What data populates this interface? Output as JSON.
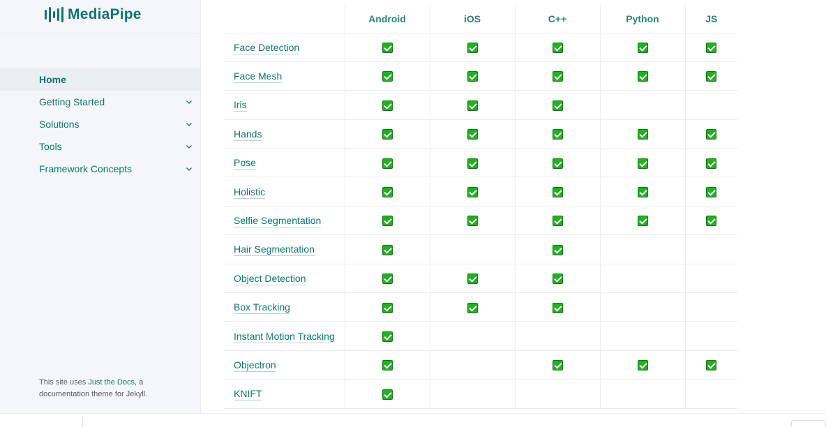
{
  "brand": {
    "name": "MediaPipe"
  },
  "nav": {
    "items": [
      {
        "label": "Home",
        "active": true,
        "expandable": false
      },
      {
        "label": "Getting Started",
        "active": false,
        "expandable": true
      },
      {
        "label": "Solutions",
        "active": false,
        "expandable": true
      },
      {
        "label": "Tools",
        "active": false,
        "expandable": true
      },
      {
        "label": "Framework Concepts",
        "active": false,
        "expandable": true
      }
    ]
  },
  "footer": {
    "prefix": "This site uses ",
    "link": "Just the Docs",
    "suffix": ", a documentation theme for Jekyll."
  },
  "table": {
    "columns": [
      "",
      "Android",
      "iOS",
      "C++",
      "Python",
      "JS"
    ],
    "rows": [
      {
        "solution": "Face Detection",
        "android": true,
        "ios": true,
        "cpp": true,
        "python": true,
        "js": true
      },
      {
        "solution": "Face Mesh",
        "android": true,
        "ios": true,
        "cpp": true,
        "python": true,
        "js": true
      },
      {
        "solution": "Iris",
        "android": true,
        "ios": true,
        "cpp": true,
        "python": false,
        "js": false
      },
      {
        "solution": "Hands",
        "android": true,
        "ios": true,
        "cpp": true,
        "python": true,
        "js": true
      },
      {
        "solution": "Pose",
        "android": true,
        "ios": true,
        "cpp": true,
        "python": true,
        "js": true
      },
      {
        "solution": "Holistic",
        "android": true,
        "ios": true,
        "cpp": true,
        "python": true,
        "js": true
      },
      {
        "solution": "Selfie Segmentation",
        "android": true,
        "ios": true,
        "cpp": true,
        "python": true,
        "js": true
      },
      {
        "solution": "Hair Segmentation",
        "android": true,
        "ios": false,
        "cpp": true,
        "python": false,
        "js": false
      },
      {
        "solution": "Object Detection",
        "android": true,
        "ios": true,
        "cpp": true,
        "python": false,
        "js": false
      },
      {
        "solution": "Box Tracking",
        "android": true,
        "ios": true,
        "cpp": true,
        "python": false,
        "js": false
      },
      {
        "solution": "Instant Motion Tracking",
        "android": true,
        "ios": false,
        "cpp": false,
        "python": false,
        "js": false
      },
      {
        "solution": "Objectron",
        "android": true,
        "ios": false,
        "cpp": true,
        "python": true,
        "js": true
      },
      {
        "solution": "KNIFT",
        "android": true,
        "ios": false,
        "cpp": false,
        "python": false,
        "js": false
      }
    ]
  },
  "colors": {
    "accent": "#0f766e",
    "check": "#22b022",
    "sidebar_bg": "#f5f6fa"
  },
  "icons": {
    "check": "white-heavy-check-mark-icon",
    "chevron": "chevron-down-icon",
    "logo": "mediapipe-logo-icon"
  }
}
